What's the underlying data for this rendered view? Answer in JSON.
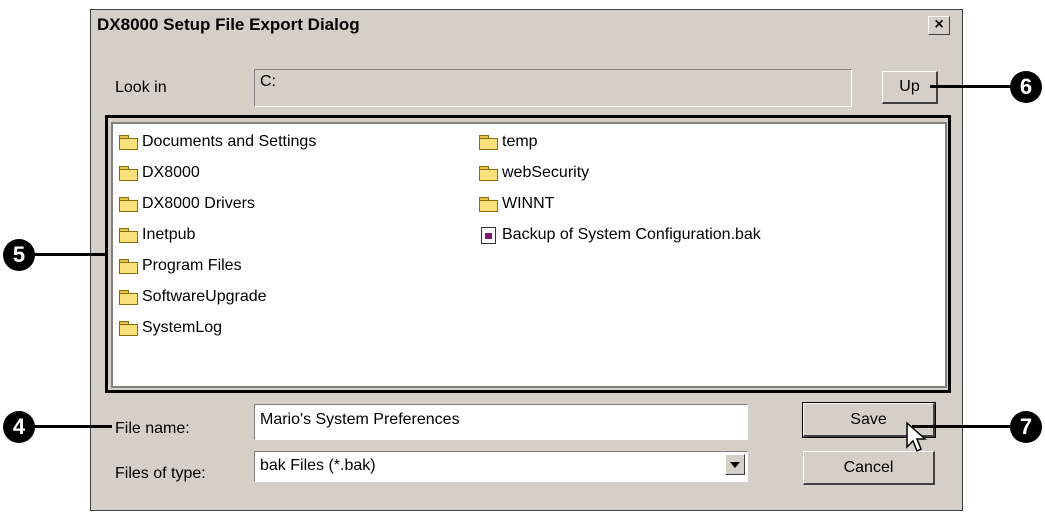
{
  "dialog": {
    "title": "DX8000 Setup File Export Dialog",
    "close_label": "×"
  },
  "look_in": {
    "label": "Look in",
    "value": "C:",
    "up_label": "Up"
  },
  "file_list": {
    "column1": [
      {
        "name": "Documents and Settings",
        "icon": "folder-icon"
      },
      {
        "name": "DX8000",
        "icon": "folder-icon"
      },
      {
        "name": "DX8000 Drivers",
        "icon": "folder-icon"
      },
      {
        "name": "Inetpub",
        "icon": "folder-icon"
      },
      {
        "name": "Program Files",
        "icon": "folder-icon"
      },
      {
        "name": "SoftwareUpgrade",
        "icon": "folder-icon"
      },
      {
        "name": "SystemLog",
        "icon": "folder-icon"
      }
    ],
    "column2": [
      {
        "name": "temp",
        "icon": "folder-icon"
      },
      {
        "name": "webSecurity",
        "icon": "folder-icon"
      },
      {
        "name": "WINNT",
        "icon": "folder-icon"
      },
      {
        "name": "Backup of System Configuration.bak",
        "icon": "file-icon"
      }
    ]
  },
  "file_name": {
    "label": "File name:",
    "value": "Mario's System Preferences"
  },
  "file_type": {
    "label": "Files of type:",
    "value": "bak Files (*.bak)"
  },
  "buttons": {
    "save": "Save",
    "cancel": "Cancel"
  },
  "callouts": {
    "c4": "4",
    "c5": "5",
    "c6": "6",
    "c7": "7"
  }
}
